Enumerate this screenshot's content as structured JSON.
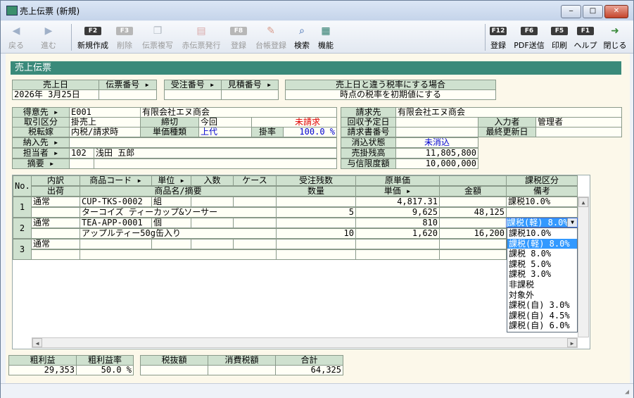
{
  "window": {
    "title": "売上伝票 (新規)",
    "min": "‒",
    "max": "□",
    "close": "✕"
  },
  "toolbar": {
    "back": "戻る",
    "forward": "進む",
    "new_key": "F2",
    "new": "新規作成",
    "delete_key": "F3",
    "delete": "削除",
    "copy": "伝票複写",
    "red": "赤伝票発行",
    "issue_key": "F8",
    "issue": "登録",
    "ledger": "台帳登録",
    "search": "検索",
    "func": "機能",
    "save_key": "F12",
    "save": "登録",
    "pdf_key": "F6",
    "pdf": "PDF送信",
    "print_key": "F5",
    "print": "印刷",
    "help_key": "F1",
    "help": "ヘルプ",
    "close": "閉じる"
  },
  "section_title": "売上伝票",
  "header": {
    "sales_date_label": "売上日",
    "slip_no_label": "伝票番号",
    "sales_date": "2026年 3月25日",
    "slip_no": "",
    "order_no_label": "受注番号",
    "estimate_no_label": "見積番号",
    "tax_rate_label": "売上日と違う税率にする場合",
    "tax_rate_value": "時点の税率を初期値にする"
  },
  "customer": {
    "customer_label": "得意先",
    "customer_code": "E001",
    "customer_name": "有限会社エヌ商会",
    "billto_label": "請求先",
    "billto_name": "有限会社エヌ商会",
    "trade_label": "取引区分",
    "trade_value": "掛売上",
    "closing_label": "締切",
    "closing_value": "今回",
    "billing_status": "未請求",
    "collect_label": "回収予定日",
    "entry_label": "入力者",
    "entry_value": "管理者",
    "tax_label": "税転嫁",
    "tax_value": "内税/請求時",
    "price_type_label": "単価種類",
    "price_type_value": "上代",
    "rate_label": "掛率",
    "rate_value": "100.0 %",
    "invoice_label": "請求書番号",
    "updated_label": "最終更新日",
    "ship_label": "納入先",
    "clear_label": "消込状態",
    "clear_value": "未消込",
    "staff_label": "担当者",
    "staff_code": "102",
    "staff_name": "浅田 五郎",
    "receivable_label": "売掛残高",
    "receivable_value": "11,805,800",
    "memo_label": "摘要",
    "credit_label": "与信限度額",
    "credit_value": "10,000,000"
  },
  "grid": {
    "col_no": "No.",
    "col_detail": "内訳",
    "col_ship": "出荷",
    "col_code": "商品コード",
    "col_unit": "単位",
    "col_qty_in": "入数",
    "col_case": "ケース",
    "col_name": "商品名/摘要",
    "col_order_rem": "受注残数",
    "col_qty": "数量",
    "col_cost": "原単価",
    "col_price": "単価",
    "col_amount": "金額",
    "col_tax": "課税区分",
    "col_note": "備考",
    "rows": [
      {
        "no": "1",
        "detail": "通常",
        "code": "CUP-TKS-0002",
        "unit": "組",
        "name": "ターコイズ ティーカップ&ソーサー",
        "qty": "5",
        "cost": "4,817.31",
        "price": "9,625",
        "amount": "48,125",
        "tax": "課税10.0%"
      },
      {
        "no": "2",
        "detail": "通常",
        "code": "TEA-APP-0001",
        "unit": "個",
        "name": "アップルティー50g缶入り",
        "qty": "10",
        "cost": "810",
        "price": "1,620",
        "amount": "16,200",
        "tax": "課税(軽) 8.0%"
      },
      {
        "no": "3",
        "detail": "通常",
        "code": "",
        "unit": "",
        "name": "",
        "qty": "",
        "cost": "",
        "price": "",
        "amount": "",
        "tax": ""
      }
    ]
  },
  "tax_dropdown": {
    "selected": "課税(軽) 8.0%",
    "options": [
      "課税10.0%",
      "課税(軽) 8.0%",
      "課税 8.0%",
      "課税 5.0%",
      "課税 3.0%",
      "非課税",
      "対象外",
      "課税(自) 3.0%",
      "課税(自) 4.5%",
      "課税(自) 6.0%"
    ]
  },
  "totals": {
    "gross_label": "粗利益",
    "gross_value": "29,353",
    "gross_rate_label": "粗利益率",
    "gross_rate_value": "50.0 %",
    "net_label": "税抜額",
    "net_value": "",
    "tax_label": "消費税額",
    "tax_value": "",
    "total_label": "合計",
    "total_value": "64,325"
  },
  "colors": {
    "section": "#3a8a7a",
    "header_cell": "#cfe1cf",
    "content_bg": "#fcf8ea",
    "red": "#e00000",
    "blue": "#0000d0",
    "highlight": "#3399ff"
  }
}
